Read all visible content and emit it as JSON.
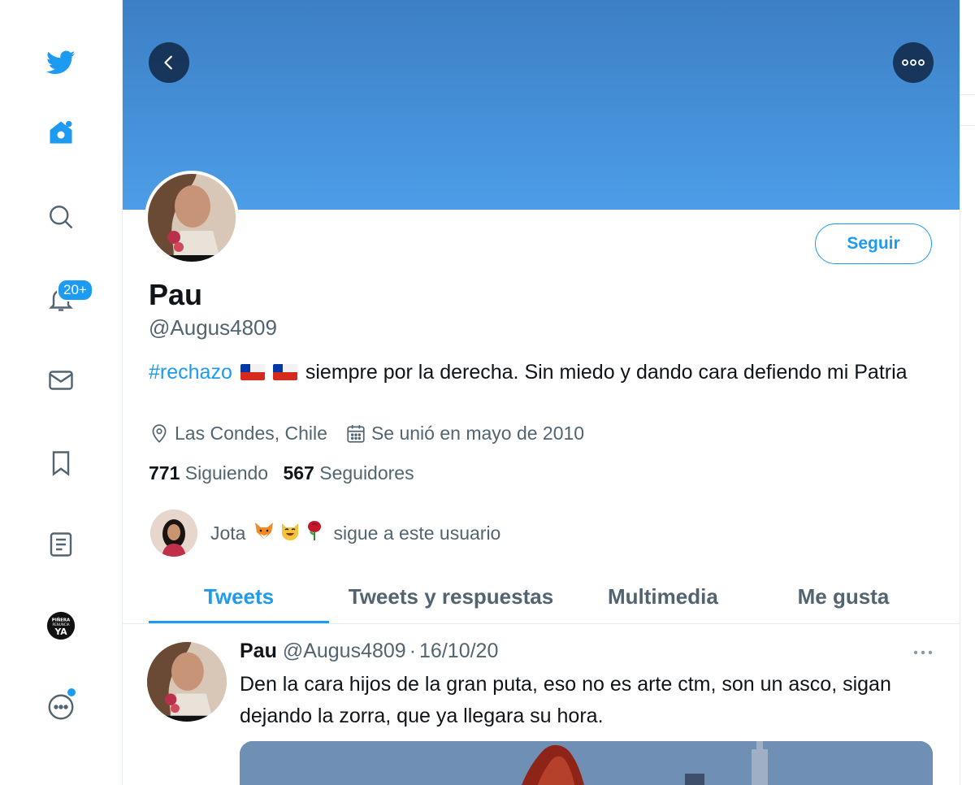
{
  "nav": {
    "icons": [
      "twitter-bird-icon",
      "home-icon",
      "search-icon",
      "bell-icon",
      "mail-icon",
      "bookmark-icon",
      "list-icon",
      "profile-avatar-icon",
      "more-icon"
    ],
    "notifications_badge": "20+",
    "avatar_text": [
      "PIÑERA",
      "RENUNCIA",
      "YA"
    ]
  },
  "colors": {
    "accent": "#1d9bf0",
    "banner_top": "#3d7fc4",
    "banner_bottom": "#4c9de8",
    "muted": "#536471"
  },
  "profile": {
    "follow_label": "Seguir",
    "name": "Pau",
    "handle": "@Augus4809",
    "bio_tag": "#rechazo",
    "bio_text": "siempre por la derecha. Sin miedo y dando cara defiendo mi Patria",
    "location": "Las Condes, Chile",
    "joined": "Se unió en mayo de 2010",
    "following_count": "771",
    "following_label": "Siguiendo",
    "followers_count": "567",
    "followers_label": "Seguidores",
    "followed_by_name": "Jota",
    "followed_by_text": "sigue a este usuario"
  },
  "tabs": [
    {
      "label": "Tweets",
      "active": true
    },
    {
      "label": "Tweets y respuestas",
      "active": false
    },
    {
      "label": "Multimedia",
      "active": false
    },
    {
      "label": "Me gusta",
      "active": false
    }
  ],
  "tweet": {
    "name": "Pau",
    "handle": "@Augus4809",
    "separator": "·",
    "date": "16/10/20",
    "text": "Den la cara hijos de la gran puta, eso no es arte ctm, son un asco, sigan dejando la zorra, que ya llegara su hora."
  }
}
